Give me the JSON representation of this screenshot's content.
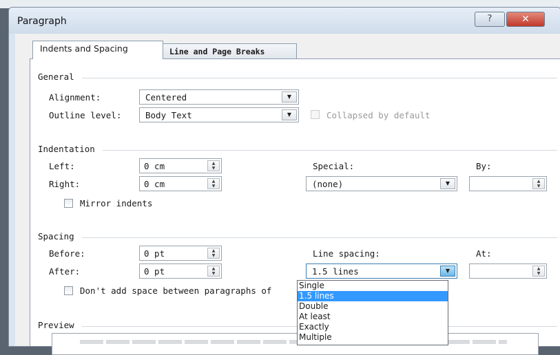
{
  "window": {
    "title": "Paragraph",
    "help_glyph": "?",
    "close_glyph": "✕"
  },
  "tabs": [
    {
      "label": "Indents and Spacing"
    },
    {
      "label": "Line and Page Breaks"
    }
  ],
  "general": {
    "heading": "General",
    "alignment_label": "Alignment:",
    "alignment_value": "Centered",
    "outline_label": "Outline level:",
    "outline_value": "Body Text",
    "collapsed_label": "Collapsed by default"
  },
  "indentation": {
    "heading": "Indentation",
    "left_label": "Left:",
    "left_value": "0 cm",
    "right_label": "Right:",
    "right_value": "0 cm",
    "special_label": "Special:",
    "special_value": "(none)",
    "by_label": "By:",
    "by_value": "",
    "mirror_label": "Mirror indents"
  },
  "spacing": {
    "heading": "Spacing",
    "before_label": "Before:",
    "before_value": "0 pt",
    "after_label": "After:",
    "after_value": "0 pt",
    "line_spacing_label": "Line spacing:",
    "line_spacing_value": "1.5 lines",
    "at_label": "At:",
    "at_value": "",
    "dont_add_label": "Don't add space between paragraphs of"
  },
  "line_spacing_options": [
    "Single",
    "1.5 lines",
    "Double",
    "At least",
    "Exactly",
    "Multiple"
  ],
  "line_spacing_selected_index": 1,
  "preview": {
    "heading": "Preview"
  },
  "icons": {
    "combo_arrow": "▼",
    "spin_up": "▲",
    "spin_down": "▼"
  }
}
